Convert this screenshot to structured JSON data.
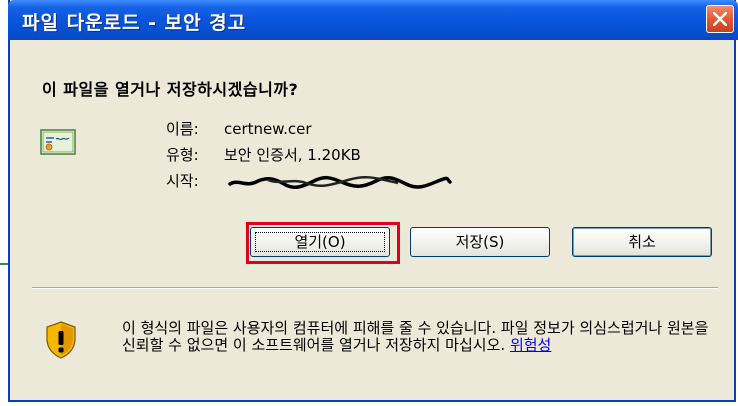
{
  "window": {
    "title": "파일 다운로드 - 보안 경고",
    "close_icon": "close-icon"
  },
  "prompt": {
    "question": "이 파일을 열거나 저장하시겠습니까?"
  },
  "file": {
    "icon": "certificate-icon",
    "name_label": "이름:",
    "name_value": "certnew.cer",
    "type_label": "유형:",
    "type_value": "보안 인증서, 1.20KB",
    "from_label": "시작:"
  },
  "buttons": {
    "open_label": "열기(O)",
    "save_label": "저장(S)",
    "cancel_label": "취소"
  },
  "warning": {
    "icon": "shield-warning-icon",
    "text": "이 형식의 파일은 사용자의 컴퓨터에 피해를 줄 수 있습니다. 파일 정보가 의심스럽거나 원본을 신뢰할 수 없으면 이 소프트웨어를 열거나 저장하지 마십시오.",
    "link_label": "위험성"
  },
  "colors": {
    "titlebar": "#0b56dc",
    "highlight": "#e0001a",
    "dialog_bg": "#ece9d8",
    "link": "#0000ff"
  }
}
